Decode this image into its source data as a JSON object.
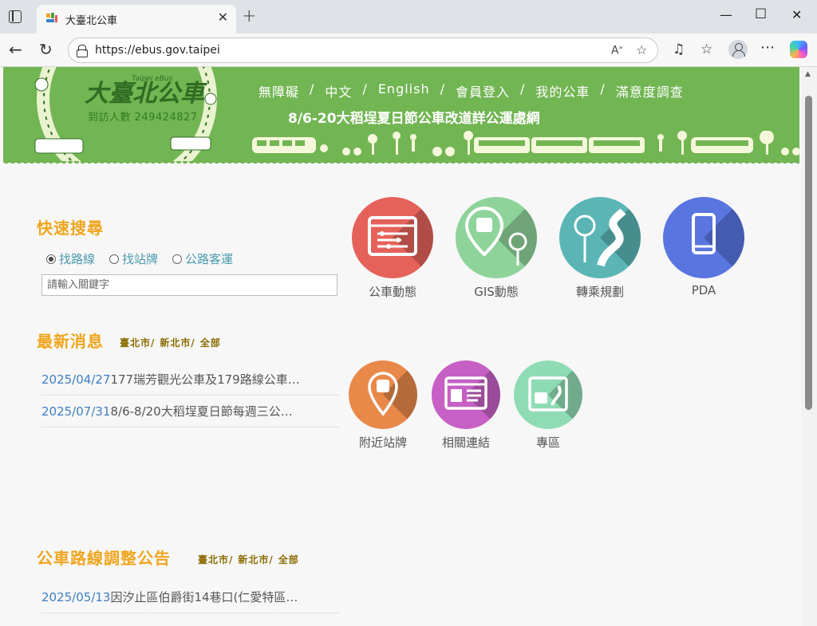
{
  "browser": {
    "tab_title": "大臺北公車",
    "url": "https://ebus.gov.taipei"
  },
  "banner": {
    "logo_title": "大臺北公車",
    "logo_subtitle": "Taipei eBus",
    "visitor_counter": "到訪人數 249424827",
    "nav": [
      "無障礙",
      "中文",
      "English",
      "會員登入",
      "我的公車",
      "滿意度調查"
    ],
    "nav_separator": "/",
    "headline": "8/6-20大稻埕夏日節公車改道詳公運處網"
  },
  "quick_search": {
    "title": "快速搜尋",
    "options": [
      {
        "label": "找路線",
        "selected": true
      },
      {
        "label": "找站牌",
        "selected": false
      },
      {
        "label": "公路客運",
        "selected": false
      }
    ],
    "placeholder": "請輸入關鍵字"
  },
  "top_tiles": [
    {
      "label": "公車動態",
      "color": "#e5625a",
      "icon": "bus-dynamics-icon"
    },
    {
      "label": "GIS動態",
      "color": "#8ed39a",
      "icon": "gis-bus-stop-icon"
    },
    {
      "label": "轉乘規劃",
      "color": "#5bb5b5",
      "icon": "transfer-route-icon"
    },
    {
      "label": "PDA",
      "color": "#5975e0",
      "icon": "mobile-phone-icon"
    }
  ],
  "latest_news": {
    "title": "最新消息",
    "filters": [
      "臺北市/",
      "新北市/",
      "全部"
    ],
    "items": [
      {
        "date": "2025/04/27",
        "text": "177瑞芳觀光公車及179路線公車…"
      },
      {
        "date": "2025/07/31",
        "text": "8/6-8/20大稻埕夏日節每週三公…"
      }
    ]
  },
  "bottom_tiles": [
    {
      "label": "附近站牌",
      "color": "#e8894a",
      "icon": "nearby-stop-icon"
    },
    {
      "label": "相關連結",
      "color": "#c660c4",
      "icon": "related-links-icon"
    },
    {
      "label": "專區",
      "color": "#8fdcb4",
      "icon": "special-section-icon"
    }
  ],
  "route_notices": {
    "title": "公車路線調整公告",
    "filters": [
      "臺北市/",
      "新北市/",
      "全部"
    ],
    "items": [
      {
        "date": "2025/05/13",
        "text": "因汐止區伯爵街14巷口(仁愛特區…"
      }
    ]
  }
}
